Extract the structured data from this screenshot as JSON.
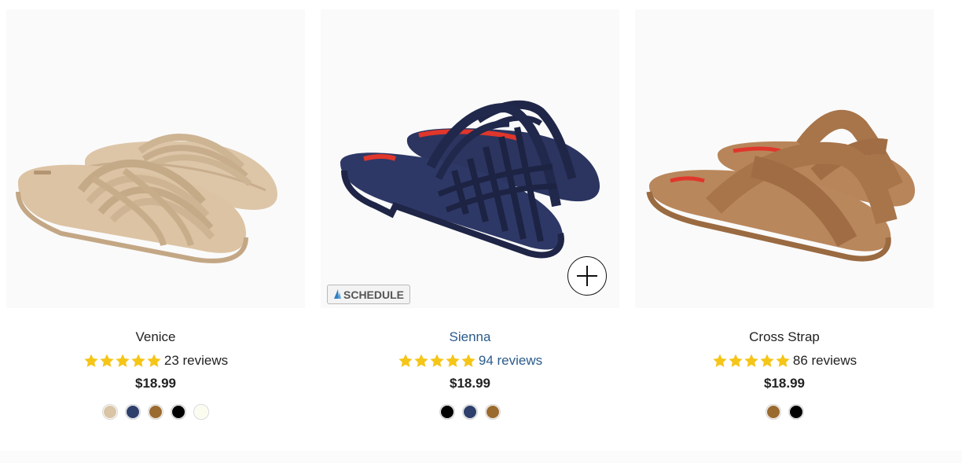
{
  "products": [
    {
      "name": "Venice",
      "rating_stars": 5,
      "reviews_text": "23 reviews",
      "price": "$18.99",
      "swatches": [
        "#d9c4a5",
        "#2f3f6c",
        "#9a6a2f",
        "#000000",
        "#fbfbee"
      ]
    },
    {
      "name": "Sienna",
      "rating_stars": 5,
      "reviews_text": "94 reviews",
      "price": "$18.99",
      "swatches": [
        "#000000",
        "#2f3f6c",
        "#9a6a2f"
      ],
      "schedule_label": "SCHEDULE"
    },
    {
      "name": "Cross Strap",
      "rating_stars": 5,
      "reviews_text": "86 reviews",
      "price": "$18.99",
      "swatches": [
        "#9a6a2f",
        "#000000"
      ]
    }
  ],
  "colors": {
    "star": "#f5c518",
    "link": "#2b5b8b",
    "sandal_beige": "#d8bfa0",
    "sandal_navy": "#2a3358",
    "sandal_brown": "#b07c52",
    "brand_red": "#e0362b"
  }
}
